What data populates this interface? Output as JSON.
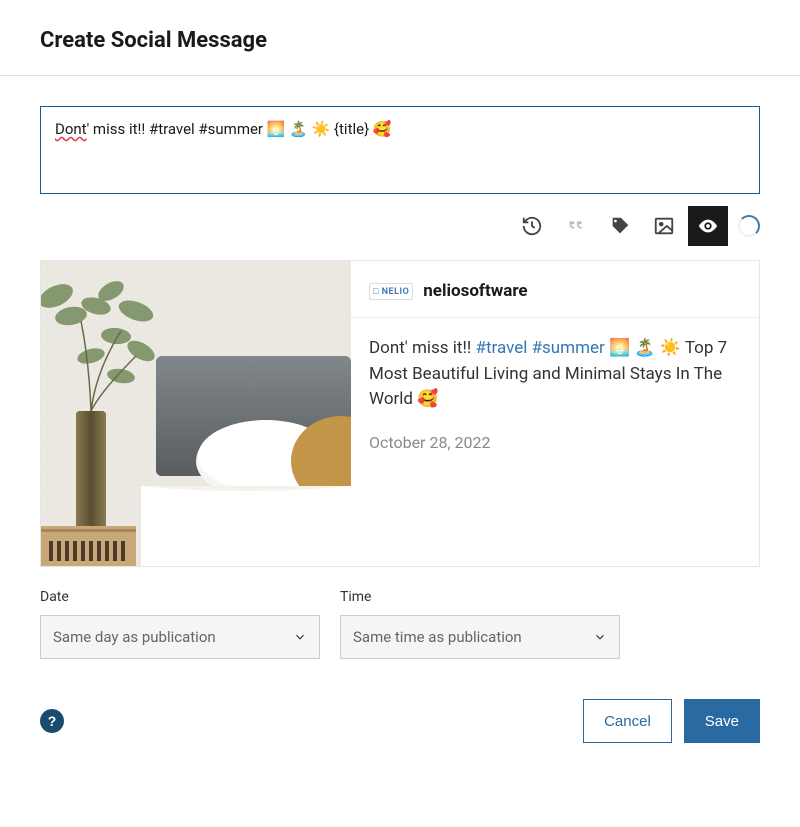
{
  "header": {
    "title": "Create Social Message"
  },
  "message": {
    "text_misspelled": "Dont",
    "text_rest": "' miss it!! #travel #summer 🌅 🏝️ ☀️ {title} 🥰"
  },
  "toolbar": {
    "items": [
      {
        "name": "history-icon",
        "active": false,
        "muted": false
      },
      {
        "name": "quote-icon",
        "active": false,
        "muted": true
      },
      {
        "name": "tag-icon",
        "active": false,
        "muted": false
      },
      {
        "name": "image-icon",
        "active": false,
        "muted": false
      },
      {
        "name": "preview-icon",
        "active": true,
        "muted": false
      }
    ]
  },
  "preview": {
    "brand_short": "□ NELIO",
    "brand_name": "neliosoftware",
    "text_plain_before": "Dont' miss it!! ",
    "hashtags": [
      "#travel",
      "#summer"
    ],
    "text_plain_after": " 🌅 🏝️ ☀️ Top 7 Most Beautiful Living and Minimal Stays In The World 🥰",
    "date": "October 28, 2022"
  },
  "datetime": {
    "date_label": "Date",
    "date_value": "Same day as publication",
    "time_label": "Time",
    "time_value": "Same time as publication"
  },
  "footer": {
    "help": "?",
    "cancel": "Cancel",
    "save": "Save"
  }
}
